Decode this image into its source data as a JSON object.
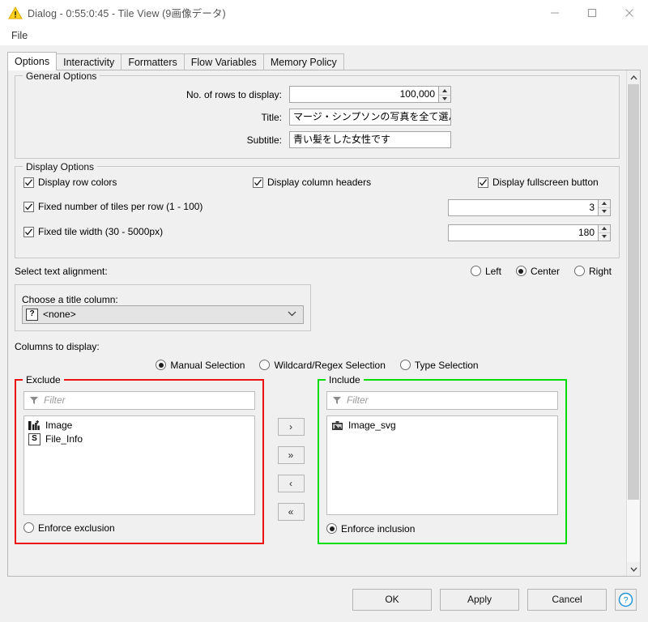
{
  "window": {
    "title": "Dialog - 0:55:0:45 - Tile View (9画像データ)",
    "icon": "warning-triangle-icon",
    "minimize_label": "–",
    "maximize_label": "□",
    "close_label": "✕"
  },
  "menubar": {
    "items": [
      {
        "label": "File"
      }
    ]
  },
  "tabs": [
    {
      "label": "Options",
      "active": true
    },
    {
      "label": "Interactivity",
      "active": false
    },
    {
      "label": "Formatters",
      "active": false
    },
    {
      "label": "Flow Variables",
      "active": false
    },
    {
      "label": "Memory Policy",
      "active": false
    }
  ],
  "general_options": {
    "legend": "General Options",
    "rows_label": "No. of rows to display:",
    "rows_value": "100,000",
    "title_label": "Title:",
    "title_value": "マージ・シンプソンの写真を全て選んでく",
    "subtitle_label": "Subtitle:",
    "subtitle_value": "青い髪をした女性です"
  },
  "display_options": {
    "legend": "Display Options",
    "row_colors_label": "Display row colors",
    "row_colors_checked": true,
    "column_headers_label": "Display column headers",
    "column_headers_checked": true,
    "fullscreen_label": "Display fullscreen button",
    "fullscreen_checked": true,
    "tiles_per_row_label": "Fixed number of tiles per row (1 - 100)",
    "tiles_per_row_checked": true,
    "tiles_per_row_value": "3",
    "tile_width_label": "Fixed tile width (30 - 5000px)",
    "tile_width_checked": true,
    "tile_width_value": "180"
  },
  "alignment": {
    "label": "Select text alignment:",
    "options": [
      {
        "label": "Left",
        "selected": false
      },
      {
        "label": "Center",
        "selected": true
      },
      {
        "label": "Right",
        "selected": false
      }
    ]
  },
  "title_column": {
    "legend": "Choose a title column:",
    "selected": "<none>",
    "type_icon": "question-mark-icon",
    "dropdown_icon": "chevron-down-icon"
  },
  "columns": {
    "label": "Columns to display:",
    "selection_modes": [
      {
        "label": "Manual Selection",
        "selected": true
      },
      {
        "label": "Wildcard/Regex Selection",
        "selected": false
      },
      {
        "label": "Type Selection",
        "selected": false
      }
    ],
    "exclude": {
      "title": "Exclude",
      "filter_placeholder": "Filter",
      "items": [
        {
          "label": "Image",
          "icon": "image-type-icon"
        },
        {
          "label": "File_Info",
          "icon": "string-type-icon",
          "icon_letter": "S"
        }
      ],
      "enforce_label": "Enforce exclusion",
      "enforce_selected": false,
      "border_color": "#ee1111"
    },
    "include": {
      "title": "Include",
      "filter_placeholder": "Filter",
      "items": [
        {
          "label": "Image_svg",
          "icon": "svg-type-icon"
        }
      ],
      "enforce_label": "Enforce inclusion",
      "enforce_selected": true,
      "border_color": "#00dd00"
    },
    "transfer_buttons": [
      {
        "label": "›",
        "name": "move-right-button"
      },
      {
        "label": "»",
        "name": "move-all-right-button"
      },
      {
        "label": "‹",
        "name": "move-left-button"
      },
      {
        "label": "«",
        "name": "move-all-left-button"
      }
    ]
  },
  "footer": {
    "ok_label": "OK",
    "apply_label": "Apply",
    "cancel_label": "Cancel",
    "help_label": "?"
  },
  "scrollbar": {
    "up_icon": "▲",
    "down_icon": "▼"
  }
}
